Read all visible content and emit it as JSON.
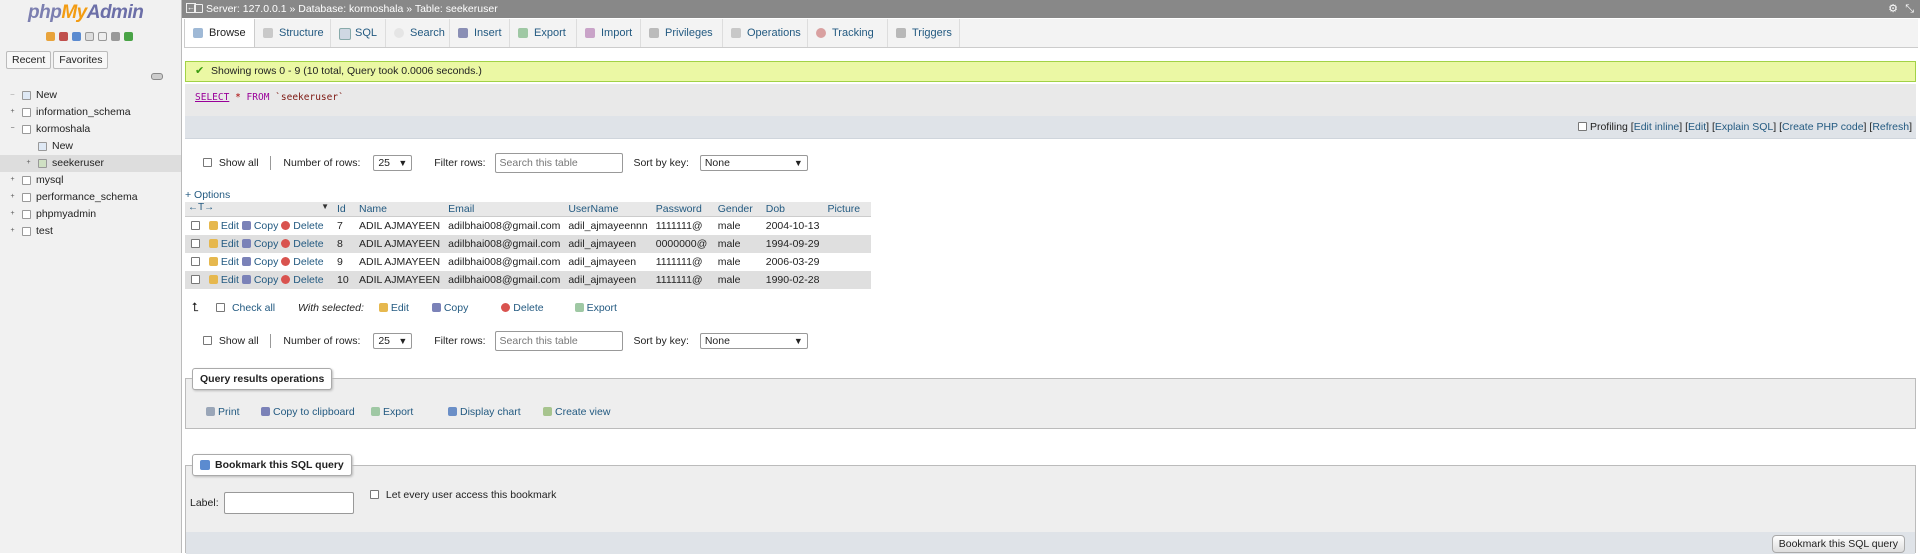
{
  "app": {
    "logo_php": "php",
    "logo_my": "My",
    "logo_admin": "Admin"
  },
  "sidebar": {
    "tabs": [
      "Recent",
      "Favorites"
    ],
    "tree": [
      {
        "label": "New",
        "level": 0
      },
      {
        "label": "information_schema",
        "level": 0
      },
      {
        "label": "kormoshala",
        "level": 0
      },
      {
        "label": "New",
        "level": 1
      },
      {
        "label": "seekeruser",
        "level": 1
      },
      {
        "label": "mysql",
        "level": 0
      },
      {
        "label": "performance_schema",
        "level": 0
      },
      {
        "label": "phpmyadmin",
        "level": 0
      },
      {
        "label": "test",
        "level": 0
      }
    ]
  },
  "breadcrumb": {
    "server": "Server: 127.0.0.1",
    "sep1": "»",
    "database": "Database: kormoshala",
    "sep2": "»",
    "table": "Table: seekeruser"
  },
  "tabs": [
    "Browse",
    "Structure",
    "SQL",
    "Search",
    "Insert",
    "Export",
    "Import",
    "Privileges",
    "Operations",
    "Tracking",
    "Triggers"
  ],
  "colors": {
    "link": "#235a81",
    "success_bg": "#ebf8a4",
    "success_border": "#a2d246",
    "topbar": "#888888"
  },
  "message": {
    "text": "Showing rows 0 - 9 (10 total, Query took 0.0006 seconds.)"
  },
  "query": {
    "select": "SELECT",
    "star": "*",
    "from": "FROM",
    "table": "`seekeruser`"
  },
  "profiling": {
    "label": "Profiling",
    "links": [
      "Edit inline",
      "Edit",
      "Explain SQL",
      "Create PHP code",
      "Refresh"
    ]
  },
  "nav": {
    "show_all": "Show all",
    "rows_label": "Number of rows:",
    "rows_value": "25",
    "filter_label": "Filter rows:",
    "filter_placeholder": "Search this table",
    "sort_label": "Sort by key:",
    "sort_value": "None"
  },
  "options_link": "+ Options",
  "table": {
    "columns": [
      "Id",
      "Name",
      "Email",
      "UserName",
      "Password",
      "Gender",
      "Dob",
      "Picture"
    ],
    "actions": [
      "Edit",
      "Copy",
      "Delete"
    ],
    "rows": [
      [
        "7",
        "ADIL AJMAYEEN",
        "adilbhai008@gmail.com",
        "adil_ajmayeennn",
        "1111111@",
        "male",
        "2004-10-13",
        ""
      ],
      [
        "8",
        "ADIL AJMAYEEN",
        "adilbhai008@gmail.com",
        "adil_ajmayeen",
        "0000000@",
        "male",
        "1994-09-29",
        ""
      ],
      [
        "9",
        "ADIL AJMAYEEN",
        "adilbhai008@gmail.com",
        "adil_ajmayeen",
        "1111111@",
        "male",
        "2006-03-29",
        ""
      ],
      [
        "10",
        "ADIL AJMAYEEN",
        "adilbhai008@gmail.com",
        "adil_ajmayeen",
        "1111111@",
        "male",
        "1990-02-28",
        ""
      ]
    ]
  },
  "with_selected": {
    "check_all": "Check all",
    "label": "With selected:",
    "edit": "Edit",
    "copy": "Copy",
    "delete": "Delete",
    "export": "Export"
  },
  "query_ops": {
    "legend": "Query results operations",
    "items": [
      "Print",
      "Copy to clipboard",
      "Export",
      "Display chart",
      "Create view"
    ]
  },
  "bookmark": {
    "legend": "Bookmark this SQL query",
    "label": "Label:",
    "every_user": "Let every user access this bookmark",
    "button": "Bookmark this SQL query"
  }
}
